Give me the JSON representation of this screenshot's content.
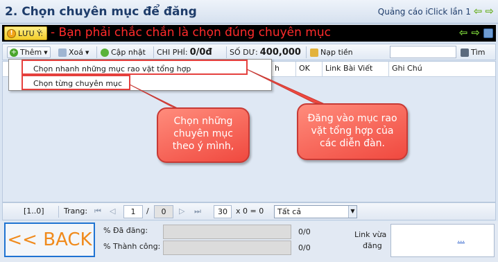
{
  "title": {
    "heading": "2. Chọn chuyên mục để đăng",
    "right_text": "Quảng cáo iClick lần 1"
  },
  "warning": {
    "button_label": "LƯU Ý:",
    "message": "- Bạn phải chắc chắn là chọn đúng chuyên mục"
  },
  "toolbar": {
    "add_label": "Thêm",
    "delete_label": "Xoá",
    "update_label": "Cập nhật",
    "cost_label": "CHI PHÍ:",
    "cost_value": "0/0đ",
    "balance_label": "SỐ DƯ:",
    "balance_value": "400,000",
    "topup_label": "Nạp tiền",
    "search_label": "Tìm"
  },
  "grid": {
    "columns": [
      "h",
      "OK",
      "Link Bài Viết",
      "Ghi Chú"
    ]
  },
  "menu": {
    "items": [
      "Chọn nhanh những mục rao vặt tổng hợp",
      "Chọn từng chuyên mục"
    ]
  },
  "callouts": {
    "left": [
      "Chọn những",
      "chuyên mục",
      "theo ý mình,"
    ],
    "right": [
      "Đăng vào mục rao",
      "vặt tổng hợp của",
      "các diễn đàn."
    ]
  },
  "pager": {
    "range": "[1..0]",
    "page_label": "Trang:",
    "page_value": "1",
    "slash": "/",
    "total_pages": "0",
    "page_size": "30",
    "calc_text": "x  0  =  0",
    "filter_value": "Tất cả"
  },
  "bottom": {
    "back_label": "<< BACK",
    "posted_label": "% Đã đăng:",
    "posted_value": "0/0",
    "posted_progress": 0,
    "success_label": "% Thành công:",
    "success_value": "0/0",
    "success_progress": 0,
    "recent_link_label_1": "Link vừa",
    "recent_link_label_2": "đăng",
    "recent_link_value": "..."
  }
}
